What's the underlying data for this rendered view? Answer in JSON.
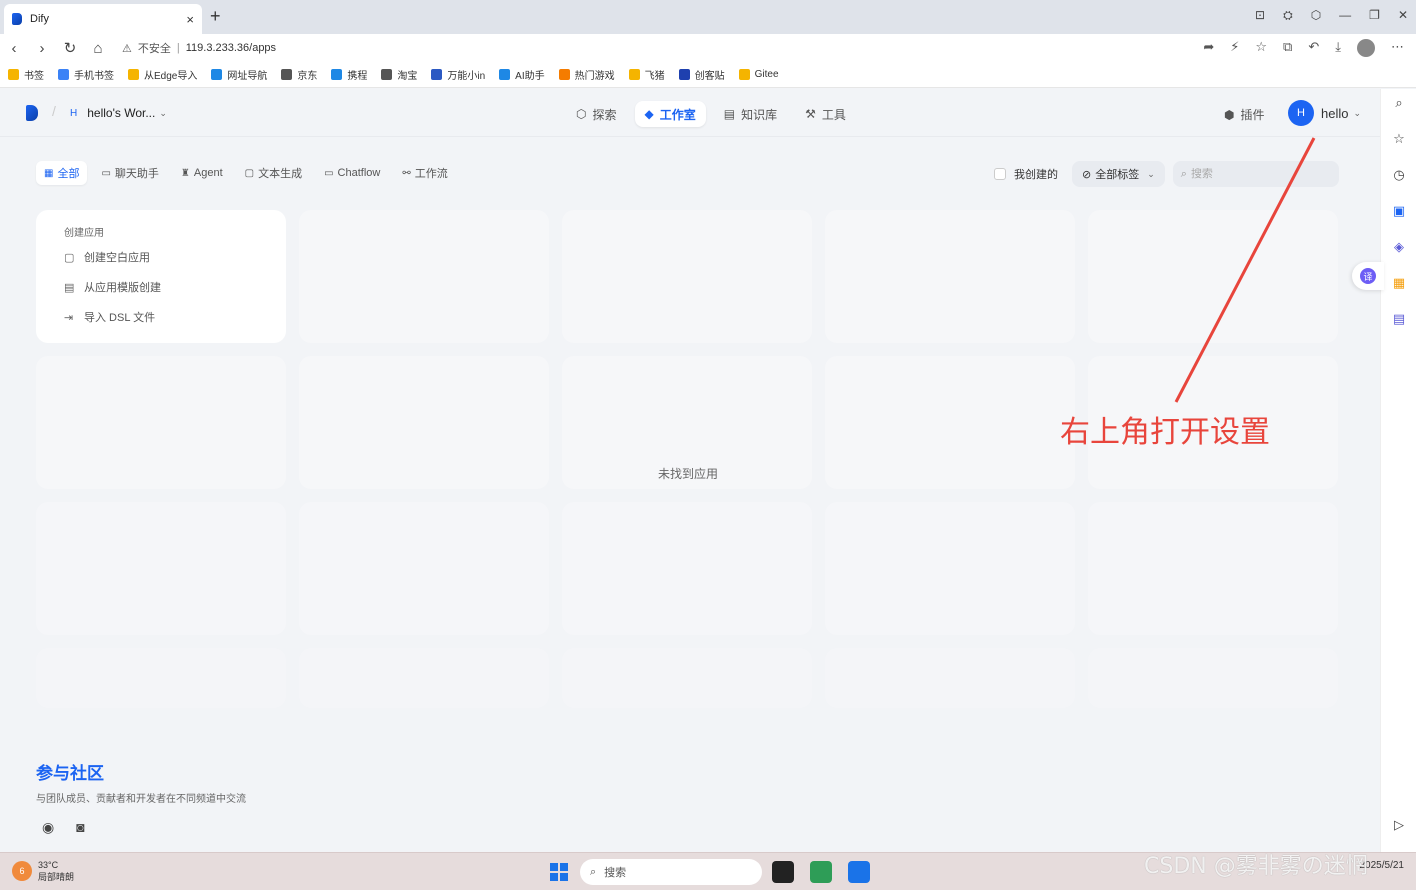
{
  "browser": {
    "tab_title": "Dify",
    "tab_close": "×",
    "new_tab": "+",
    "insecure_label": "不安全",
    "url": "119.3.233.36/apps"
  },
  "bookmarks": [
    {
      "label": "书签",
      "color": "#f5b400"
    },
    {
      "label": "手机书签",
      "color": "#3b82f6"
    },
    {
      "label": "从Edge导入",
      "color": "#f5b400"
    },
    {
      "label": "网址导航",
      "color": "#1e88e5"
    },
    {
      "label": "京东",
      "color": "#555555"
    },
    {
      "label": "携程",
      "color": "#1e88e5"
    },
    {
      "label": "淘宝",
      "color": "#555555"
    },
    {
      "label": "万能小in",
      "color": "#2b59c3"
    },
    {
      "label": "AI助手",
      "color": "#1e88e5"
    },
    {
      "label": "热门游戏",
      "color": "#f57c00"
    },
    {
      "label": "飞猪",
      "color": "#f5b400"
    },
    {
      "label": "创客贴",
      "color": "#1e40af"
    },
    {
      "label": "Gitee",
      "color": "#f5b400"
    }
  ],
  "header": {
    "workspace_initial": "H",
    "workspace_name": "hello's Wor...",
    "nav": [
      {
        "icon": "⬡",
        "label": "探索"
      },
      {
        "icon": "◆",
        "label": "工作室"
      },
      {
        "icon": "▤",
        "label": "知识库"
      },
      {
        "icon": "⚒",
        "label": "工具"
      }
    ],
    "plugin_label": "插件",
    "user_initial": "H",
    "user_name": "hello"
  },
  "filters": {
    "tabs": [
      {
        "icon": "▦",
        "label": "全部"
      },
      {
        "icon": "▭",
        "label": "聊天助手"
      },
      {
        "icon": "♜",
        "label": "Agent"
      },
      {
        "icon": "▢",
        "label": "文本生成"
      },
      {
        "icon": "▭",
        "label": "Chatflow"
      },
      {
        "icon": "⚯",
        "label": "工作流"
      }
    ],
    "created_by_me": "我创建的",
    "tags_label": "全部标签",
    "search_placeholder": "搜索"
  },
  "create_card": {
    "title": "创建应用",
    "items": [
      {
        "icon": "▢",
        "label": "创建空白应用"
      },
      {
        "icon": "▤",
        "label": "从应用模版创建"
      },
      {
        "icon": "⇥",
        "label": "导入 DSL 文件"
      }
    ]
  },
  "empty_text": "未找到应用",
  "community": {
    "title": "参与社区",
    "subtitle": "与团队成员、贡献者和开发者在不同频道中交流"
  },
  "annotation": {
    "text": "右上角打开设置",
    "color": "#e8453c"
  },
  "taskbar": {
    "weather_temp": "33°C",
    "weather_desc": "局部晴朗",
    "weather_badge": "6",
    "search_label": "搜索",
    "date": "2025/5/21"
  },
  "watermark": "CSDN @雾非雾の迷惘",
  "colors": {
    "accent": "#1c64f2"
  }
}
